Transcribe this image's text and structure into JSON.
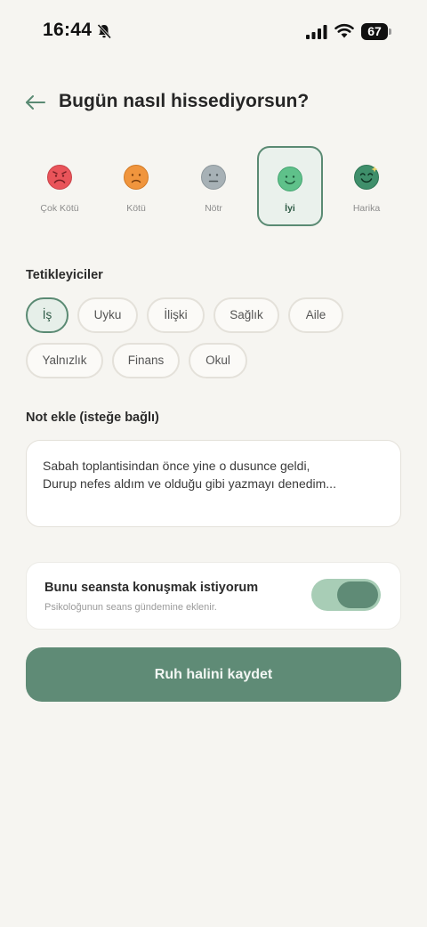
{
  "status_bar": {
    "time": "16:44",
    "battery": "67"
  },
  "header": {
    "title": "Bugün nasıl hissediyorsun?"
  },
  "moods": [
    {
      "label": "Çok Kötü",
      "icon": "very-sad-face-icon",
      "color": "#e9545a",
      "selected": false
    },
    {
      "label": "Kötü",
      "icon": "sad-face-icon",
      "color": "#f0953d",
      "selected": false
    },
    {
      "label": "Nötr",
      "icon": "neutral-face-icon",
      "color": "#a7b1b6",
      "selected": false
    },
    {
      "label": "İyi",
      "icon": "smile-face-icon",
      "color": "#5fc18a",
      "selected": true
    },
    {
      "label": "Harika",
      "icon": "great-face-icon",
      "color": "#3f8f6b",
      "selected": false
    }
  ],
  "triggers": {
    "label": "Tetikleyiciler",
    "chips": [
      {
        "label": "İş",
        "selected": true
      },
      {
        "label": "Uyku",
        "selected": false
      },
      {
        "label": "İlişki",
        "selected": false
      },
      {
        "label": "Sağlık",
        "selected": false
      },
      {
        "label": "Aile",
        "selected": false
      },
      {
        "label": "Yalnızlık",
        "selected": false
      },
      {
        "label": "Finans",
        "selected": false
      },
      {
        "label": "Okul",
        "selected": false
      }
    ]
  },
  "note": {
    "label": "Not ekle (isteğe bağlı)",
    "line1": "Sabah toplantisindan önce yine o dusunce geldi,",
    "line2": "Durup nefes aldım ve olduğu gibi yazmayı denedim..."
  },
  "session_toggle": {
    "title": "Bunu seansta konuşmak istiyorum",
    "subtitle": "Psikoloğunun seans gündemine eklenir.",
    "on": true
  },
  "save_button": {
    "label": "Ruh halini kaydet"
  },
  "colors": {
    "accent": "#5f8b76",
    "background": "#f6f5f1"
  }
}
